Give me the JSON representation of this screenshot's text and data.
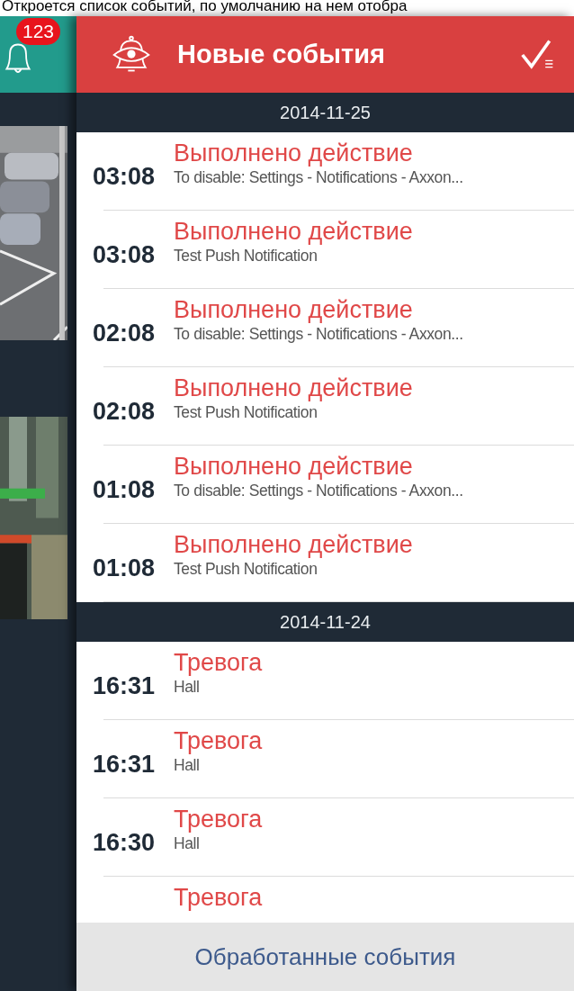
{
  "caption": "Откроется список событий, по умолчанию на нем отобра",
  "side": {
    "badge": "123"
  },
  "header": {
    "title": "Новые события"
  },
  "groups": [
    {
      "date": "2014-11-25",
      "events": [
        {
          "time": "03:08",
          "title": "Выполнено действие",
          "detail": "To disable: Settings - Notifications - Axxon..."
        },
        {
          "time": "03:08",
          "title": "Выполнено действие",
          "detail": "Test Push Notification"
        },
        {
          "time": "02:08",
          "title": "Выполнено действие",
          "detail": "To disable: Settings - Notifications - Axxon..."
        },
        {
          "time": "02:08",
          "title": "Выполнено действие",
          "detail": "Test Push Notification"
        },
        {
          "time": "01:08",
          "title": "Выполнено действие",
          "detail": "To disable: Settings - Notifications - Axxon..."
        },
        {
          "time": "01:08",
          "title": "Выполнено действие",
          "detail": "Test Push Notification"
        }
      ]
    },
    {
      "date": "2014-11-24",
      "events": [
        {
          "time": "16:31",
          "title": "Тревога",
          "detail": "Hall"
        },
        {
          "time": "16:31",
          "title": "Тревога",
          "detail": "Hall"
        },
        {
          "time": "16:30",
          "title": "Тревога",
          "detail": "Hall"
        },
        {
          "title": "Тревога"
        }
      ]
    }
  ],
  "footer": {
    "label": "Обработанные события"
  }
}
